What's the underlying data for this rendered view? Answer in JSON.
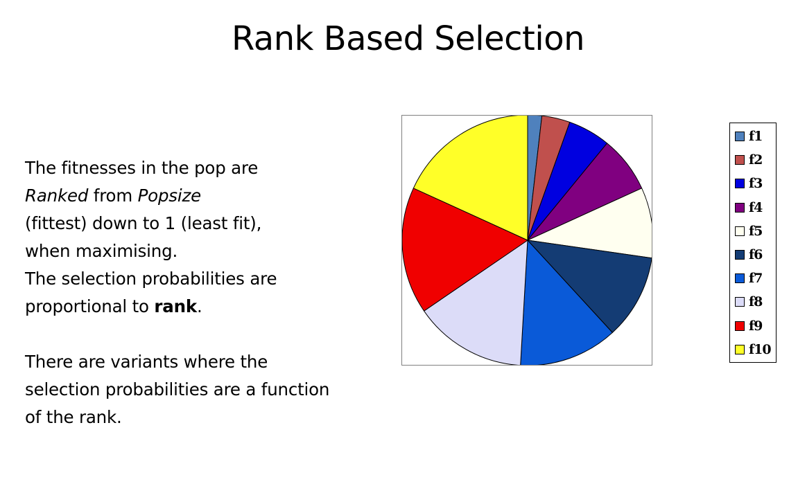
{
  "slide": {
    "title": "Rank Based Selection"
  },
  "text": {
    "line1": "The fitnesses in the pop are",
    "line2_a": "Ranked",
    "line2_b": " from ",
    "line2_c": "Popsize",
    "line3": "(fittest) down to 1 (least fit),",
    "line4": "when maximising.",
    "line5": "The selection probabilities are",
    "line6_a": "proportional to ",
    "line6_b": "rank",
    "line6_c": ".",
    "line7": "There are variants where the",
    "line8": "selection probabilities are a function",
    "line9": "of the rank."
  },
  "chart_data": {
    "type": "pie",
    "categories": [
      "f1",
      "f2",
      "f3",
      "f4",
      "f5",
      "f6",
      "f7",
      "f8",
      "f9",
      "f10"
    ],
    "values": [
      1,
      2,
      3,
      4,
      5,
      6,
      7,
      8,
      9,
      10
    ],
    "colors": [
      "#4f81bd",
      "#c0504d",
      "#0000e0",
      "#800080",
      "#fffff0",
      "#143c74",
      "#0a5ad8",
      "#dcdcf8",
      "#f00000",
      "#ffff28"
    ],
    "title": "",
    "legend": "right",
    "start_angle_deg": 0,
    "direction": "clockwise"
  }
}
